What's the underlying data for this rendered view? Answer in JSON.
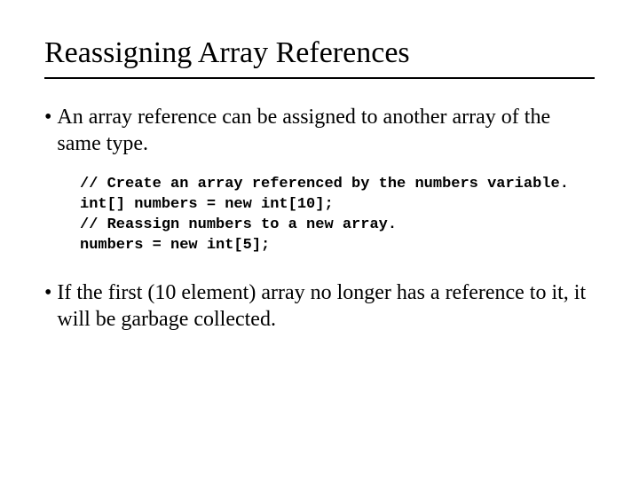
{
  "title": "Reassigning Array References",
  "bullets": {
    "b1": "An array reference can be assigned to another array of the same type.",
    "b2": "If the first (10 element) array no longer has a reference to it, it will be garbage collected."
  },
  "code": "// Create an array referenced by the numbers variable.\nint[] numbers = new int[10];\n// Reassign numbers to a new array.\nnumbers = new int[5];"
}
